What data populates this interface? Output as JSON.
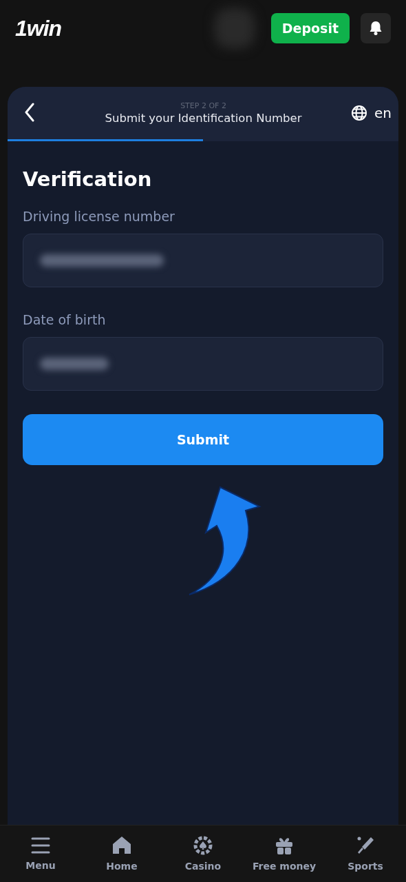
{
  "header": {
    "logo": "1win",
    "deposit_button": "Deposit"
  },
  "wizard": {
    "step": "STEP 2 OF 2",
    "title": "Submit your Identification Number",
    "language": "en",
    "progress": {
      "level": 0.5
    }
  },
  "form": {
    "heading": "Verification",
    "fields": [
      {
        "label": "Driving license number"
      },
      {
        "label": "Date of birth"
      }
    ],
    "submit": "Submit"
  },
  "bottom_nav": [
    {
      "label": "Menu",
      "kind": "menu"
    },
    {
      "label": "Home",
      "kind": "home"
    },
    {
      "label": "Casino",
      "kind": "casino"
    },
    {
      "label": "Free money",
      "kind": "gift"
    },
    {
      "label": "Sports",
      "kind": "sports"
    }
  ]
}
